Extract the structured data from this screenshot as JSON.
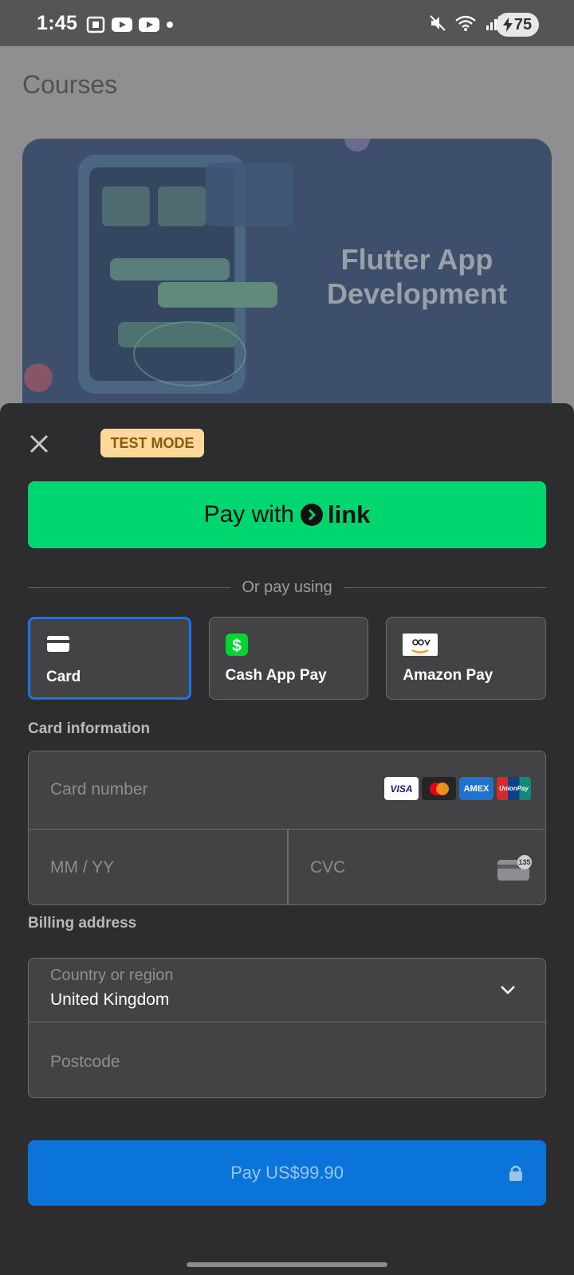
{
  "status_bar": {
    "time": "1:45",
    "battery": "75"
  },
  "background": {
    "page_title": "Courses",
    "banner_text": "Flutter App Development"
  },
  "sheet": {
    "test_mode_badge": "TEST MODE",
    "link_button": {
      "prefix": "Pay with",
      "brand": "link"
    },
    "divider_text": "Or pay using",
    "payment_methods": [
      {
        "label": "Card",
        "icon": "card-icon",
        "selected": true
      },
      {
        "label": "Cash App Pay",
        "icon": "cash-app-icon",
        "selected": false
      },
      {
        "label": "Amazon Pay",
        "icon": "amazon-pay-icon",
        "selected": false
      }
    ],
    "card_info": {
      "label": "Card information",
      "card_number_placeholder": "Card number",
      "expiry_placeholder": "MM / YY",
      "cvc_placeholder": "CVC",
      "brands": [
        "VISA",
        "Mastercard",
        "AMEX",
        "UnionPay"
      ],
      "cvc_hint": "135"
    },
    "billing": {
      "label": "Billing address",
      "country_label": "Country or region",
      "country_value": "United Kingdom",
      "postcode_placeholder": "Postcode"
    },
    "pay_button": "Pay US$99.90"
  },
  "colors": {
    "accent_blue": "#0a74da",
    "link_green": "#00d66f",
    "test_badge": "#fdd89a"
  }
}
